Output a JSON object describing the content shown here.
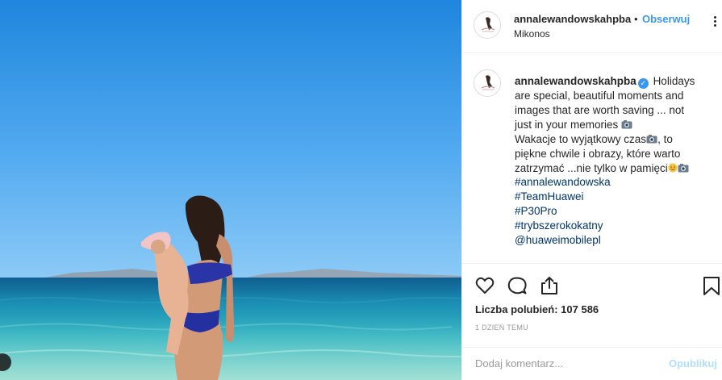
{
  "post": {
    "username": "annalewandowskahpba",
    "separator": "•",
    "follow_label": "Obserwuj",
    "location": "Mikonos",
    "caption": {
      "username": "annalewandowskahpba",
      "line1": "Holidays",
      "line2": "are special, beautiful moments and",
      "line3": "images that are worth saving ... not",
      "line4": "just in your memories",
      "line5a": "Wakacje to wyjątkowy czas",
      "line5b": ", to",
      "line6": "piękne chwile i obrazy, które warto",
      "line7": "zatrzymać ...nie tylko w pamięci",
      "tags": [
        "#annalewandowska",
        "#TeamHuawei",
        "#P30Pro",
        "#trybszerokokatny",
        "@huaweimobilepl"
      ]
    },
    "likes": "Liczba polubień: 107 586",
    "time": "1 DZIEŃ TEMU",
    "comment_placeholder": "Dodaj komentarz...",
    "post_label": "Opublikuj"
  },
  "icons": {
    "verified": "verified-badge-icon",
    "camera": "camera-emoji",
    "smile": "smiling-face-emoji",
    "like": "heart-icon",
    "comment": "comment-bubble-icon",
    "share": "share-icon",
    "save": "bookmark-icon",
    "more": "more-options-icon"
  },
  "colors": {
    "link": "#3897f0",
    "hashtag": "#003569",
    "muted": "#999999",
    "post_disabled": "#b2dffc"
  }
}
